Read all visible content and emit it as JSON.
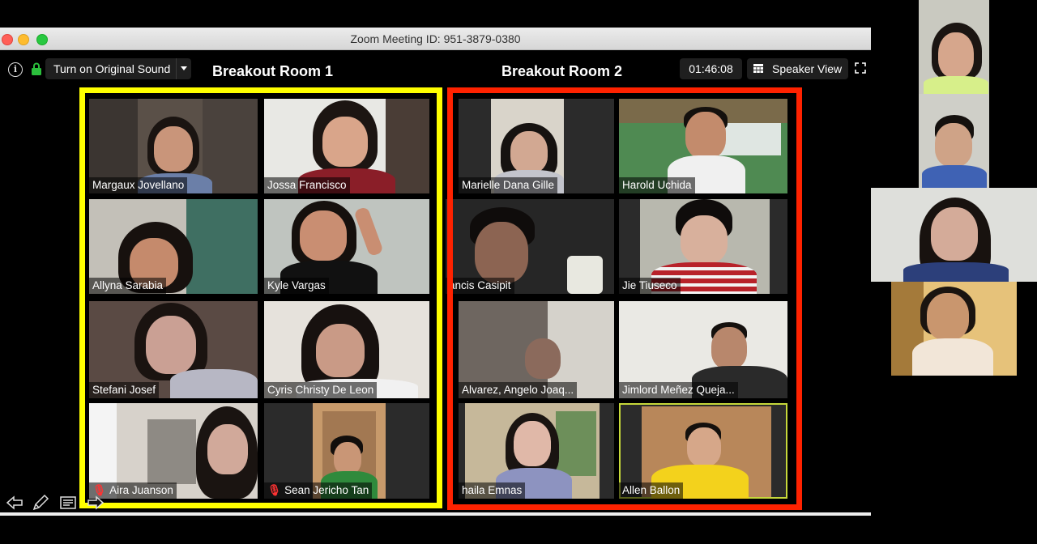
{
  "window": {
    "title": "Zoom Meeting ID: 951-3879-0380"
  },
  "toolbar": {
    "original_sound": "Turn on Original Sound",
    "timer": "01:46:08",
    "view_label": "Speaker View"
  },
  "rooms": [
    {
      "label": "Breakout Room 1",
      "color": "#ffff00"
    },
    {
      "label": "Breakout Room 2",
      "color": "#ff2200"
    }
  ],
  "participants": {
    "room1": [
      {
        "name": "Margaux Jovellano"
      },
      {
        "name": "Jossa Francisco"
      },
      {
        "name": "Allyna Sarabia"
      },
      {
        "name": "Kyle Vargas"
      },
      {
        "name": "Stefani Josef"
      },
      {
        "name": "Cyris Christy De Leon"
      },
      {
        "name": "Aira Juanson",
        "muted": true
      },
      {
        "name": "Sean Jericho Tan",
        "muted": true
      }
    ],
    "room2": [
      {
        "name": "Marielle Dana Gille"
      },
      {
        "name": "Harold Uchida"
      },
      {
        "name": "ancis Casipit"
      },
      {
        "name": "Jie Tiuseco"
      },
      {
        "name": "Alvarez, Angelo Joaq..."
      },
      {
        "name": "Jimlord Meñez Queja..."
      },
      {
        "name": "haila Emnas"
      },
      {
        "name": "Allen Ballon"
      }
    ]
  },
  "icons": {
    "info": "info-icon",
    "lock": "lock-icon",
    "grid": "grid-icon",
    "fullscreen": "fullscreen-icon",
    "muted_mic": "🎙",
    "back": "arrow-left-icon",
    "pen": "pen-icon",
    "notes": "notes-icon",
    "forward": "arrow-right-icon"
  }
}
